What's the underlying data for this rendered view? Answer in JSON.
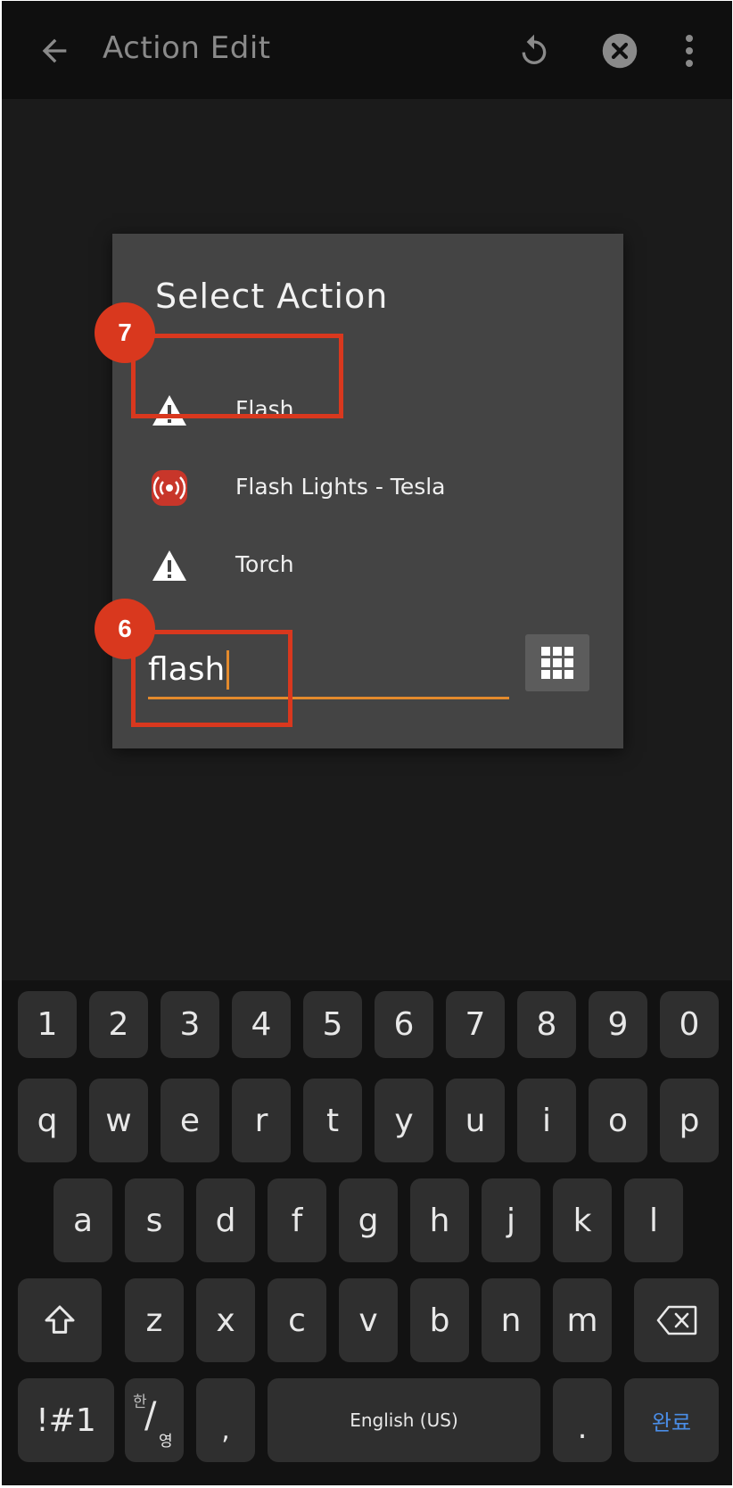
{
  "app_bar": {
    "title": "Action Edit",
    "icons": [
      "arrow-back-icon",
      "undo-icon",
      "clear-icon",
      "more-vert-icon"
    ]
  },
  "dialog": {
    "title": "Select Action",
    "actions": [
      {
        "label": "Flash",
        "icon": "warning-icon"
      },
      {
        "label": "Flash Lights - Tesla",
        "icon": "broadcast-icon"
      },
      {
        "label": "Torch",
        "icon": "warning-icon"
      }
    ],
    "search_value": "flash",
    "grid_icon": "grid-icon"
  },
  "annotations": {
    "badge_7": "7",
    "badge_6": "6"
  },
  "keyboard": {
    "row_numbers": [
      "1",
      "2",
      "3",
      "4",
      "5",
      "6",
      "7",
      "8",
      "9",
      "0"
    ],
    "row_top": [
      "q",
      "w",
      "e",
      "r",
      "t",
      "y",
      "u",
      "i",
      "o",
      "p"
    ],
    "row_middle": [
      "a",
      "s",
      "d",
      "f",
      "g",
      "h",
      "j",
      "k",
      "l"
    ],
    "row_bottom": [
      "z",
      "x",
      "c",
      "v",
      "b",
      "n",
      "m"
    ],
    "symbols_key": "!#1",
    "lang_key_top": "한",
    "lang_key_bottom": "영",
    "comma_key": ",",
    "space_label": "English (US)",
    "period_key": ".",
    "enter_label": "완료"
  },
  "colors": {
    "accent": "#e38a2c",
    "annotation": "#d9381e",
    "enter_text": "#4a8de6"
  }
}
